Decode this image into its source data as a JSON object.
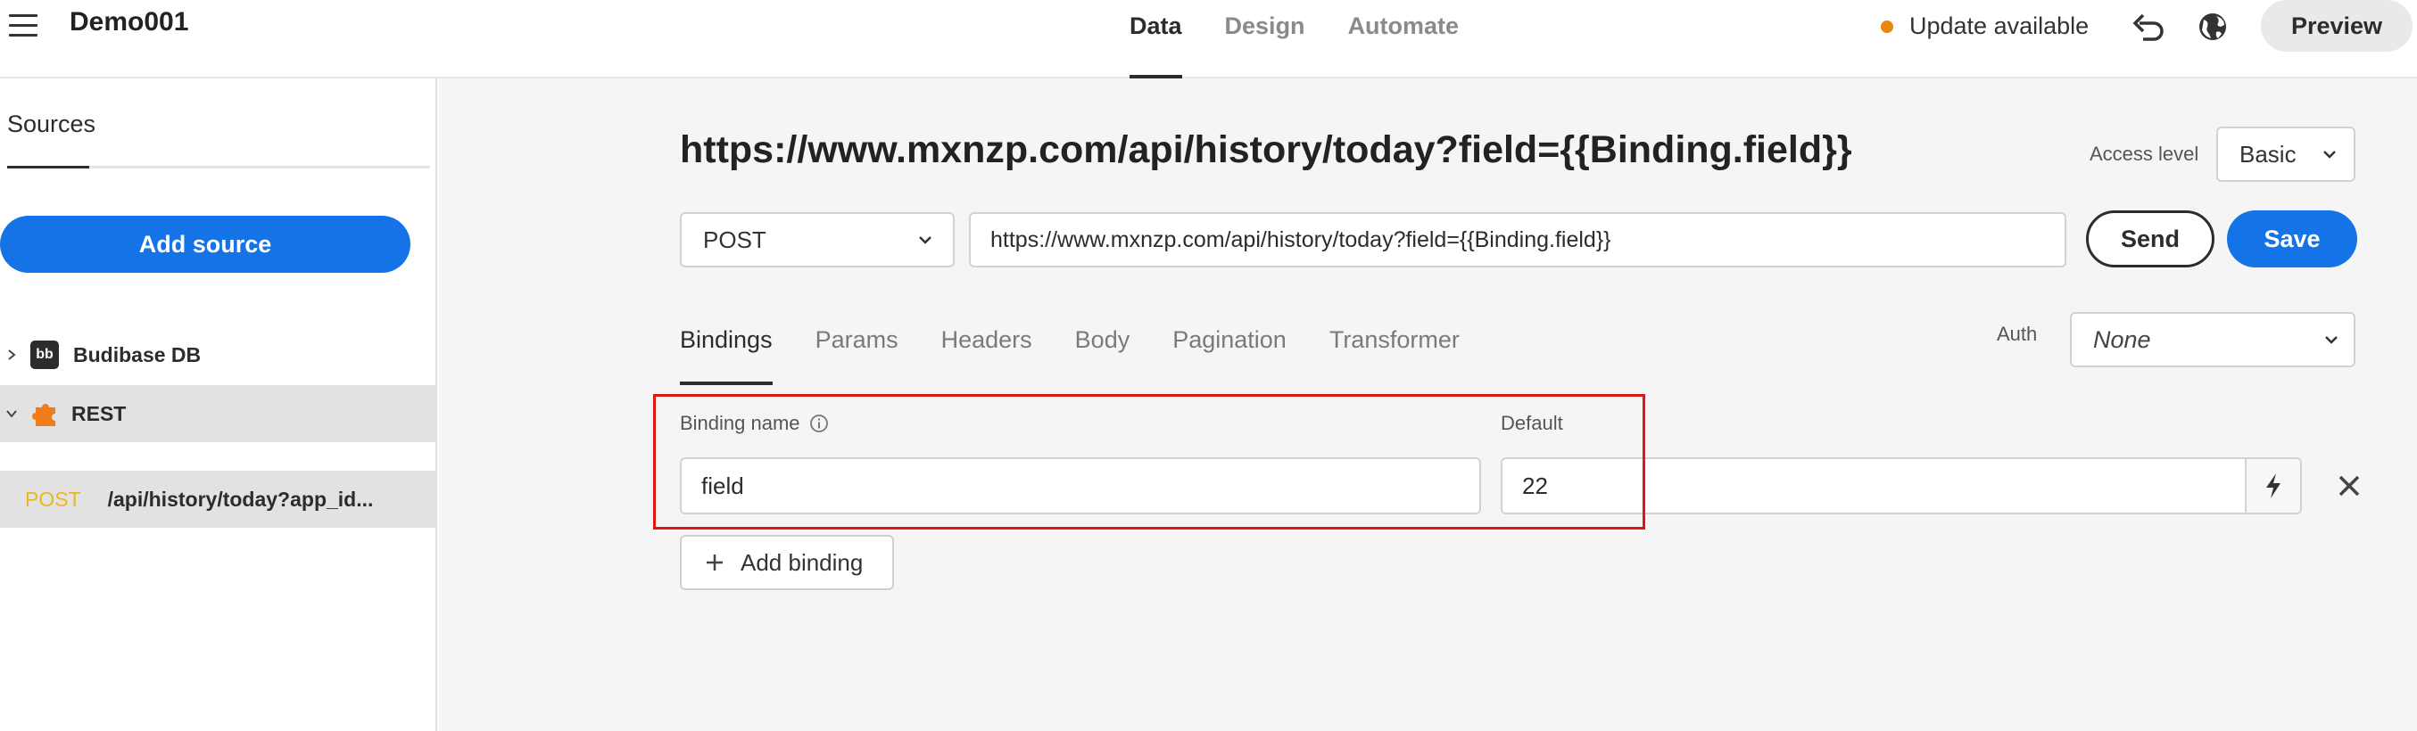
{
  "app": {
    "title": "Demo001"
  },
  "topnav": {
    "items": [
      {
        "label": "Data",
        "active": true
      },
      {
        "label": "Design",
        "active": false
      },
      {
        "label": "Automate",
        "active": false
      }
    ]
  },
  "header": {
    "update_label": "Update available",
    "update_dot_color": "#e8890c",
    "preview_label": "Preview"
  },
  "sidebar": {
    "tab_label": "Sources",
    "add_source_label": "Add source",
    "tree": [
      {
        "label": "Budibase DB",
        "icon": "budibase-db-icon",
        "expanded": false
      },
      {
        "label": "REST",
        "icon": "rest-plugin-icon",
        "expanded": true
      }
    ],
    "query": {
      "method": "POST",
      "path": "/api/history/today?app_id..."
    }
  },
  "main": {
    "title": "https://www.mxnzp.com/api/history/today?field={{Binding.field}}",
    "access_level_label": "Access level",
    "access_level_value": "Basic",
    "method_value": "POST",
    "url_value": "https://www.mxnzp.com/api/history/today?field={{Binding.field}}",
    "send_label": "Send",
    "save_label": "Save",
    "tabs": [
      {
        "label": "Bindings",
        "active": true
      },
      {
        "label": "Params",
        "active": false
      },
      {
        "label": "Headers",
        "active": false
      },
      {
        "label": "Body",
        "active": false
      },
      {
        "label": "Pagination",
        "active": false
      },
      {
        "label": "Transformer",
        "active": false
      }
    ],
    "auth_label": "Auth",
    "auth_value": "None",
    "bindings": {
      "name_header": "Binding name",
      "default_header": "Default",
      "rows": [
        {
          "name": "field",
          "default": "22"
        }
      ],
      "add_label": "Add binding"
    }
  },
  "colors": {
    "accent": "#1473e6",
    "highlight": "#e01515",
    "method_post": "#e9b91c"
  }
}
